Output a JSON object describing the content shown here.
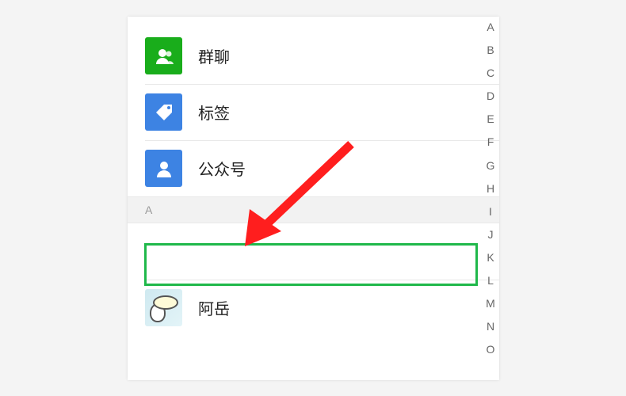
{
  "list": {
    "items": [
      {
        "id": "group-chat",
        "label": "群聊",
        "iconName": "group-chat-icon",
        "iconColor": "green"
      },
      {
        "id": "tags",
        "label": "标签",
        "iconName": "tag-icon",
        "iconColor": "blue"
      },
      {
        "id": "official-accounts",
        "label": "公众号",
        "iconName": "official-account-icon",
        "iconColor": "blue"
      }
    ],
    "sectionLetter": "A",
    "contacts": [
      {
        "label": ""
      },
      {
        "label": "阿岳"
      }
    ]
  },
  "indexBar": {
    "letters": [
      "A",
      "B",
      "C",
      "D",
      "E",
      "F",
      "G",
      "H",
      "I",
      "J",
      "K",
      "L",
      "M",
      "N",
      "O"
    ]
  },
  "annotation": {
    "highlightColor": "#1fb84a",
    "arrowColor": "#ff1e1e"
  }
}
